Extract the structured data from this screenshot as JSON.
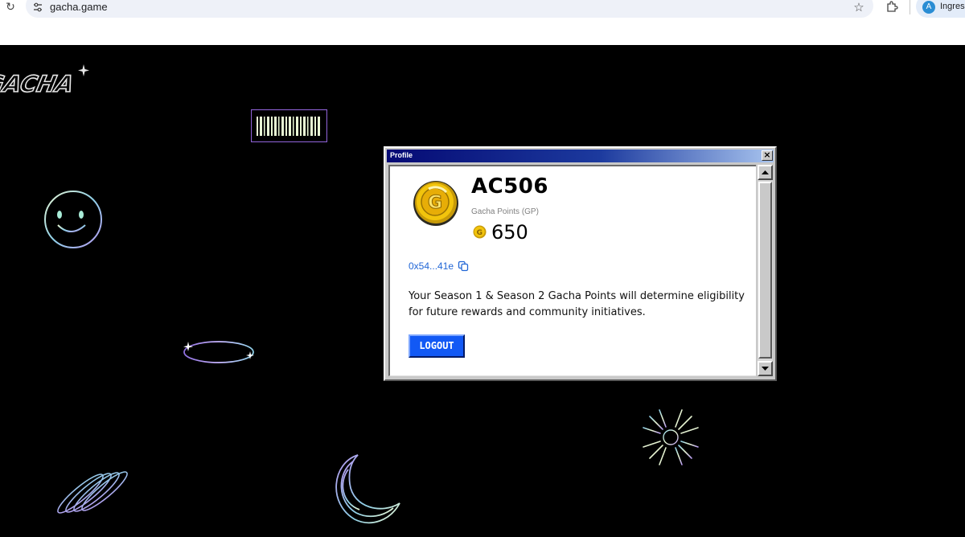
{
  "browser": {
    "url": "gacha.game",
    "profile_label": "Ingresa"
  },
  "site": {
    "logo_text": "GACHA"
  },
  "dialog": {
    "title": "Profile",
    "close_label": "×",
    "username": "AC506",
    "points_label": "Gacha Points (GP)",
    "points_value": "650",
    "wallet_address": "0x54...41e",
    "description": "Your Season 1 & Season 2 Gacha Points will determine eligibility for future rewards and community initiatives.",
    "logout_label": "LOGOUT"
  },
  "icons": {
    "reload": "reload-icon",
    "site_settings": "site-settings-icon",
    "bookmark": "star-icon",
    "extensions": "puzzle-icon",
    "copy": "copy-icon",
    "coin": "gacha-coin-icon"
  },
  "colors": {
    "page_background": "#000000",
    "titlebar": "#050a74",
    "logout_button": "#1259f5",
    "wallet_link": "#2166d6",
    "coin": "#f2c40c"
  }
}
